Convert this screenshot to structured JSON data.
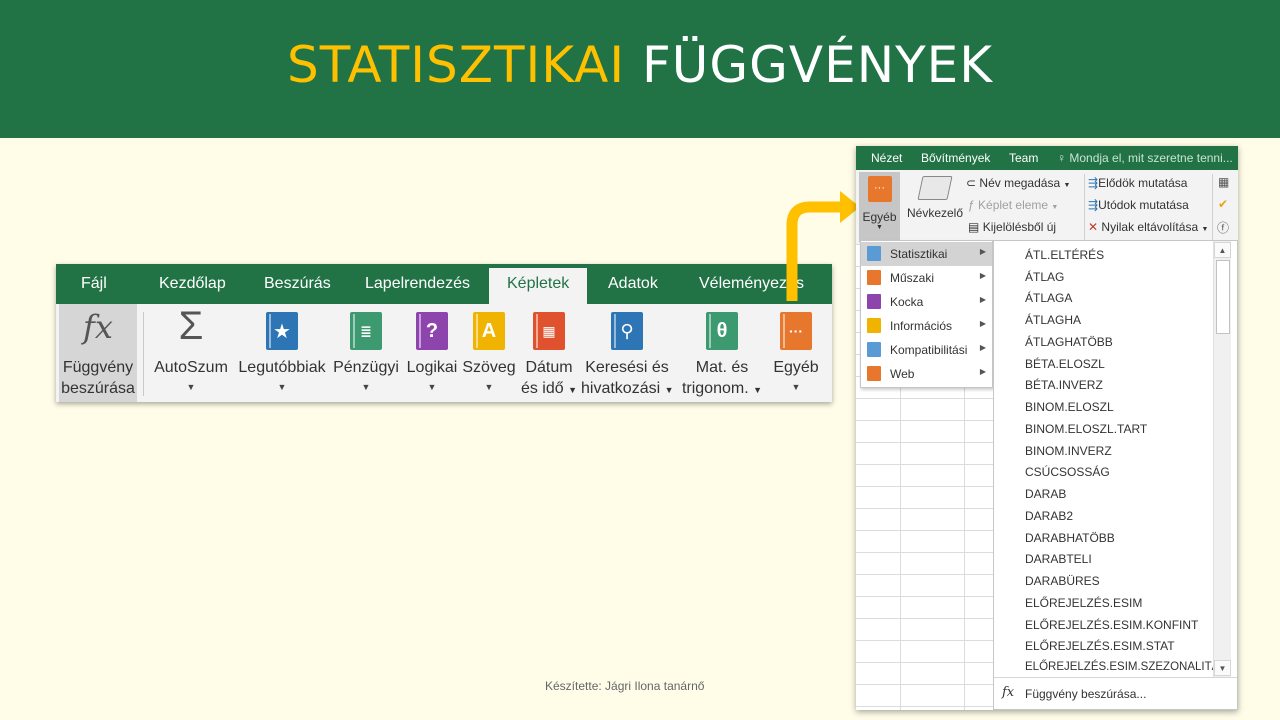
{
  "slide": {
    "title_part1": "STATISZTIKAI",
    "title_part2": "FÜGGVÉNYEK",
    "footer": "Készítette: Jágri Ilona tanárnő",
    "colors": {
      "banner": "#217346",
      "title_accent": "#ffc000",
      "arrow": "#ffc000",
      "background": "#fffde8"
    }
  },
  "ribbon": {
    "tabs": [
      "Fájl",
      "Kezdőlap",
      "Beszúrás",
      "Lapelrendezés",
      "Képletek",
      "Adatok",
      "Véleményezés"
    ],
    "active_tab": "Képletek",
    "buttons": {
      "insert_function": {
        "icon": "fx",
        "line1": "Függvény",
        "line2": "beszúrása"
      },
      "autosum": {
        "icon": "Σ",
        "label": "AutoSzum"
      },
      "recent": {
        "label": "Legutóbbiak"
      },
      "financial": {
        "label": "Pénzügyi"
      },
      "logical": {
        "label": "Logikai",
        "icon": "?"
      },
      "text": {
        "label": "Szöveg",
        "icon": "A"
      },
      "datetime": {
        "line1": "Dátum",
        "line2": "és idő"
      },
      "lookup": {
        "line1": "Keresési és",
        "line2": "hivatkozási"
      },
      "math": {
        "line1": "Mat. és",
        "line2": "trigonom.",
        "icon": "θ"
      },
      "more": {
        "label": "Egyéb",
        "icon": "···"
      }
    }
  },
  "excel": {
    "tabs": [
      "Nézet",
      "Bővítmények",
      "Team"
    ],
    "tell_me": "Mondja el, mit szeretne tenni...",
    "more_button": "Egyéb",
    "name_manager": "Névkezelő",
    "define_name": "Név megadása",
    "use_in_formula": "Képlet eleme",
    "create_from_selection": "Kijelölésből új",
    "trace_precedents": "Elődök mutatása",
    "trace_dependents": "Utódok mutatása",
    "remove_arrows": "Nyilak eltávolítása",
    "categories": [
      "Statisztikai",
      "Műszaki",
      "Kocka",
      "Információs",
      "Kompatibilitási",
      "Web"
    ],
    "selected_category": "Statisztikai",
    "functions": [
      "ÁTL.ELTÉRÉS",
      "ÁTLAG",
      "ÁTLAGA",
      "ÁTLAGHA",
      "ÁTLAGHATÖBB",
      "BÉTA.ELOSZL",
      "BÉTA.INVERZ",
      "BINOM.ELOSZL",
      "BINOM.ELOSZL.TART",
      "BINOM.INVERZ",
      "CSÚCSOSSÁG",
      "DARAB",
      "DARAB2",
      "DARABHATÖBB",
      "DARABTELI",
      "DARABÜRES",
      "ELŐREJELZÉS.ESIM",
      "ELŐREJELZÉS.ESIM.KONFINT",
      "ELŐREJELZÉS.ESIM.STAT",
      "ELŐREJELZÉS.ESIM.SZEZONALITÁS"
    ],
    "insert_function_label": "Függvény beszúrása..."
  }
}
